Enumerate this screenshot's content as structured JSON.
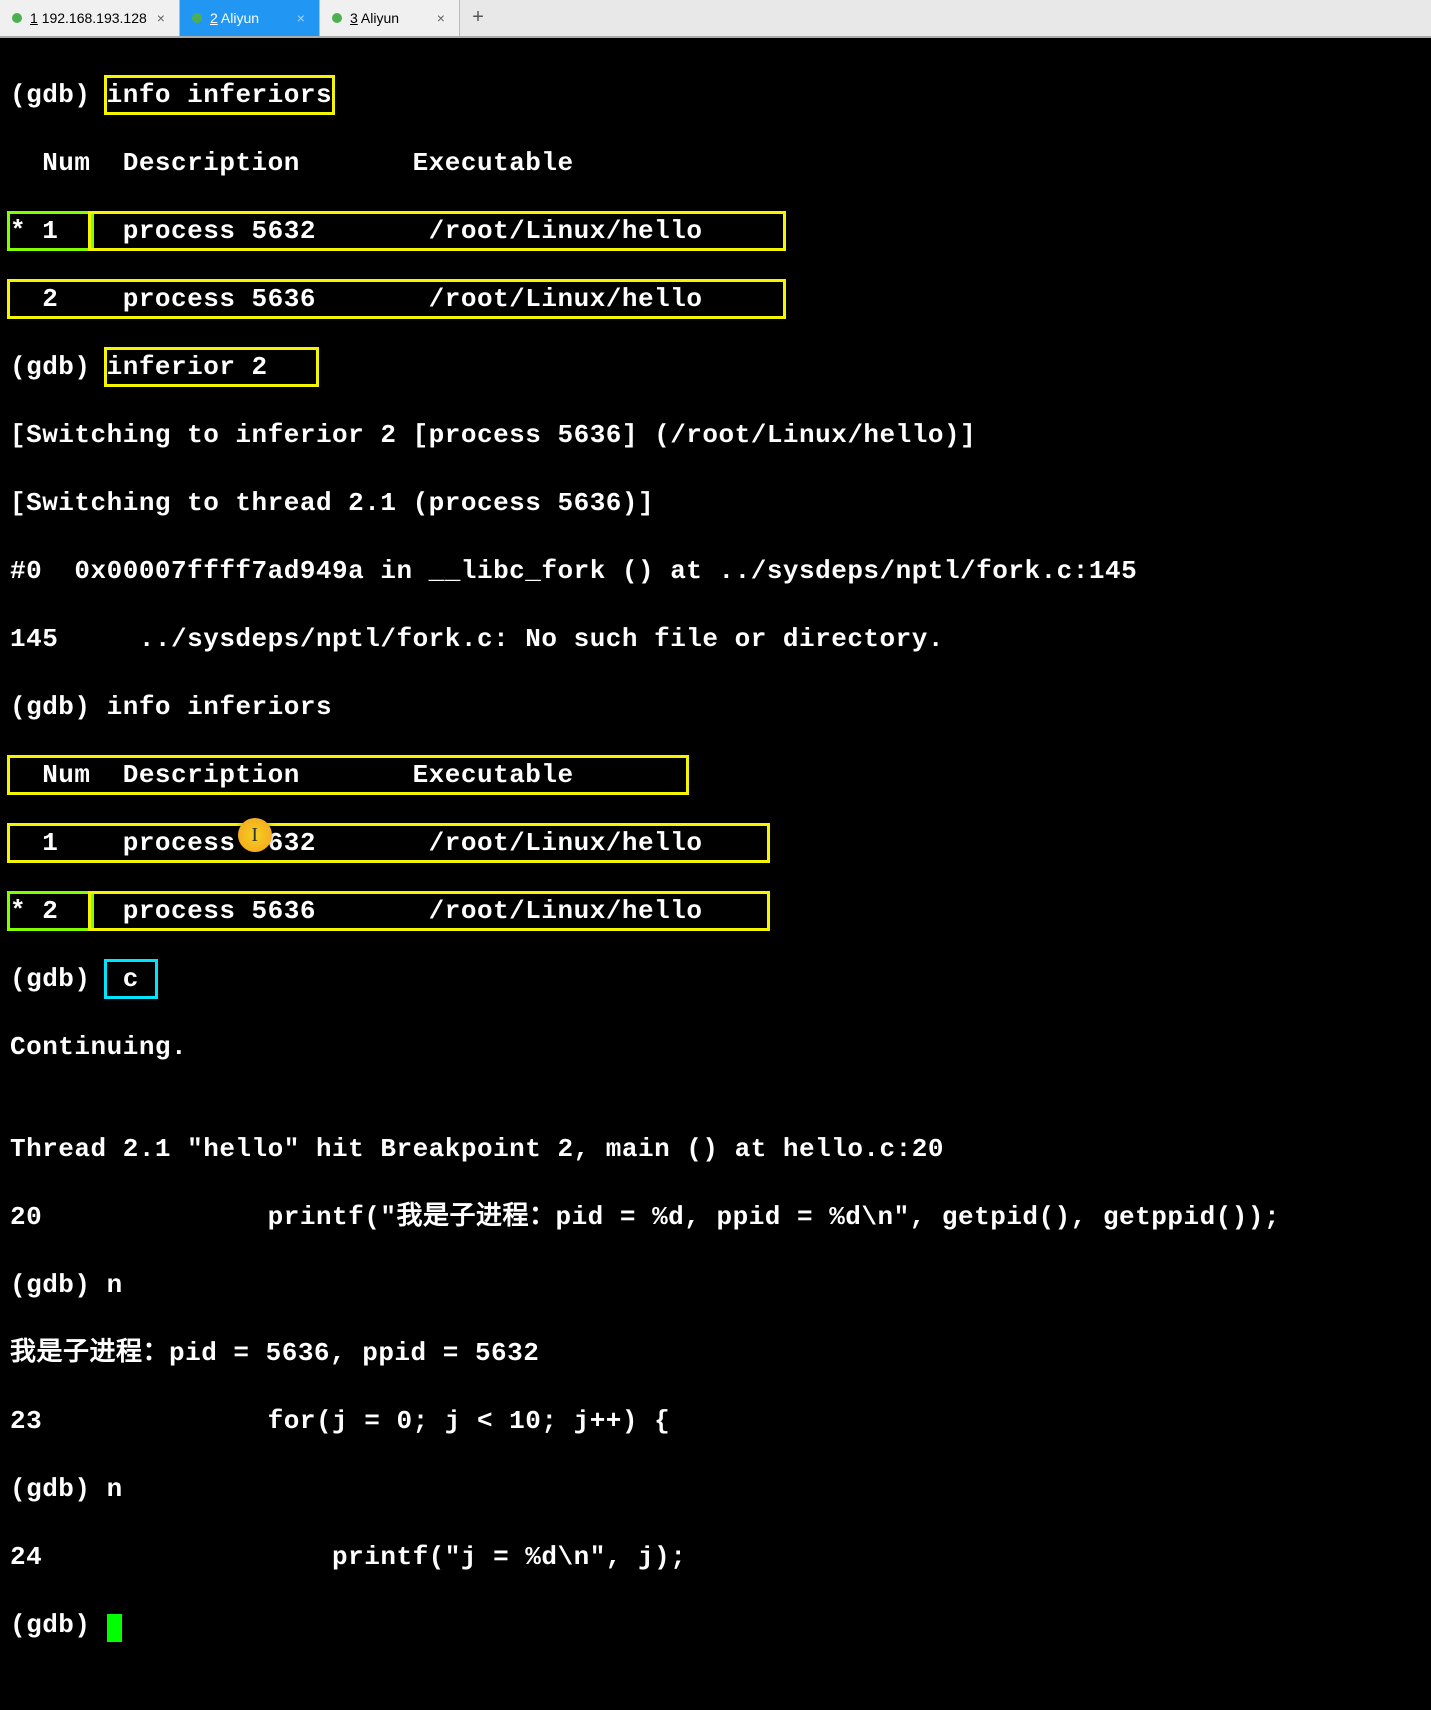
{
  "tabs": [
    {
      "num": "1",
      "label": "192.168.193.128",
      "active": false
    },
    {
      "num": "2",
      "label": "Aliyun",
      "active": true
    },
    {
      "num": "3",
      "label": "Aliyun",
      "active": false
    }
  ],
  "term": {
    "prompt": "(gdb) ",
    "cmd_info_inferiors": "info inferiors",
    "hdr_num": "  Num",
    "hdr_desc": "  Description",
    "hdr_exec": "       Executable       ",
    "row1_mark": "* 1  ",
    "row1_desc": "  process 5632       ",
    "row1_exec": "/root/Linux/hello     ",
    "row2_mark": "  2  ",
    "row2_desc": "  process 5636       ",
    "row2_exec": "/root/Linux/hello     ",
    "cmd_inferior2": "inferior 2   ",
    "switch1": "[Switching to inferior 2 [process 5636] (/root/Linux/hello)]",
    "switch2": "[Switching to thread 2.1 (process 5636)]",
    "frame0": "#0  0x00007ffff7ad949a in __libc_fork () at ../sysdeps/nptl/fork.c:145",
    "line145": "145     ../sysdeps/nptl/fork.c: No such file or directory.",
    "cmd_info_inferiors2": "info inferiors",
    "hdr2_num": "  Num",
    "hdr2_desc": "  Description",
    "hdr2_exec": "       Executable       ",
    "b_row1_mark": "  1  ",
    "b_row1_desc": "  process 5632       ",
    "b_row1_exec": "/root/Linux/hello    ",
    "b_row2_mark": "* 2  ",
    "b_row2_desc": "  process 5636       ",
    "b_row2_exec": "/root/Linux/hello    ",
    "cmd_c": " c ",
    "continuing": "Continuing.",
    "blank": "",
    "bp_hit": "Thread 2.1 \"hello\" hit Breakpoint 2, main () at hello.c:20",
    "src20": "20              printf(\"我是子进程：pid = %d, ppid = %d\\n\", getpid(), getppid());",
    "cmd_n1": "n",
    "out_child": "我是子进程：pid = 5636, ppid = 5632",
    "src23": "23              for(j = 0; j < 10; j++) {",
    "cmd_n2": "n",
    "src24": "24                  printf(\"j = %d\\n\", j);"
  }
}
